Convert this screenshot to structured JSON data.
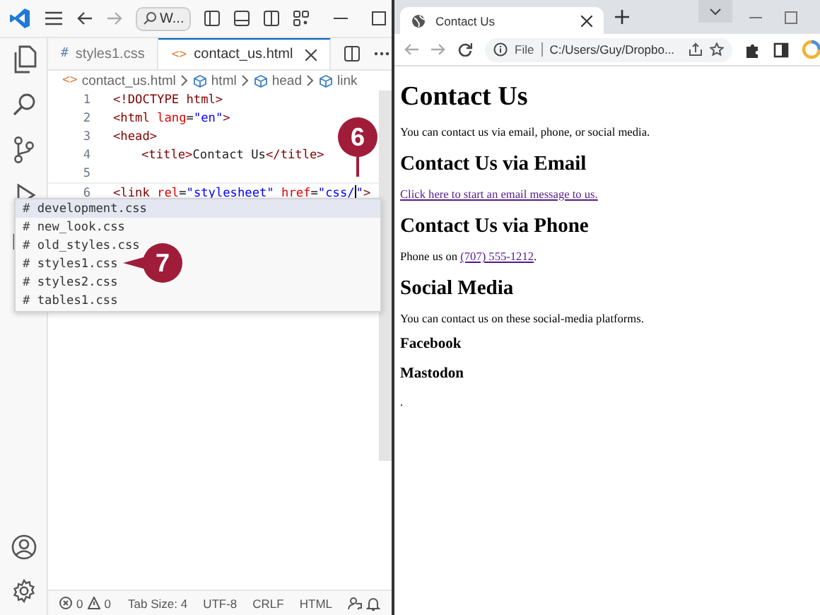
{
  "editor": {
    "command_center": "W...",
    "tabs": [
      {
        "icon": "#",
        "label": "styles1.css",
        "kind": "css",
        "selected": false
      },
      {
        "icon": "<>",
        "label": "contact_us.html",
        "kind": "html",
        "selected": true
      }
    ],
    "breadcrumbs": [
      {
        "icon": "<>",
        "label": "contact_us.html",
        "kind": "file"
      },
      {
        "label": "html",
        "kind": "element"
      },
      {
        "label": "head",
        "kind": "element"
      },
      {
        "label": "link",
        "kind": "element"
      }
    ],
    "lines": [
      {
        "number": "1",
        "current": false,
        "tokens": [
          {
            "kind": "tag",
            "text": "<!DOCTYPE html>"
          }
        ]
      },
      {
        "number": "2",
        "current": false,
        "tokens": [
          {
            "kind": "tag",
            "text": "<html"
          },
          {
            "kind": "attr",
            "text": " lang"
          },
          {
            "kind": "plain",
            "text": "="
          },
          {
            "kind": "string",
            "text": "\"en\""
          },
          {
            "kind": "tag",
            "text": ">"
          }
        ]
      },
      {
        "number": "3",
        "current": false,
        "tokens": [
          {
            "kind": "tag",
            "text": "<head>"
          }
        ]
      },
      {
        "number": "4",
        "current": false,
        "indented": true,
        "tokens": [
          {
            "kind": "tag",
            "text": "<title>"
          },
          {
            "kind": "plain",
            "text": "Contact Us"
          },
          {
            "kind": "tag",
            "text": "</title>"
          }
        ]
      },
      {
        "number": "5",
        "current": false
      },
      {
        "number": "6",
        "current": true,
        "tokens": [
          {
            "kind": "tag",
            "text": "<link"
          },
          {
            "kind": "attr",
            "text": " rel"
          },
          {
            "kind": "plain",
            "text": "="
          },
          {
            "kind": "string",
            "text": "\"stylesheet\""
          },
          {
            "kind": "attr",
            "text": " href"
          },
          {
            "kind": "plain",
            "text": "="
          },
          {
            "kind": "string",
            "text": "\"css/",
            "link": true,
            "cursor_after": true
          },
          {
            "kind": "string",
            "text": "\""
          },
          {
            "kind": "tag",
            "text": ">"
          }
        ]
      }
    ],
    "suggestions": [
      {
        "icon": "#",
        "label": "development.css",
        "selected": true
      },
      {
        "icon": "#",
        "label": "new_look.css",
        "selected": false
      },
      {
        "icon": "#",
        "label": "old_styles.css",
        "selected": false
      },
      {
        "icon": "#",
        "label": "styles1.css",
        "selected": false
      },
      {
        "icon": "#",
        "label": "styles2.css",
        "selected": false
      },
      {
        "icon": "#",
        "label": "tables1.css",
        "selected": false
      }
    ],
    "status_bar": {
      "errors": "0",
      "warnings": "0",
      "items": [
        "Tab Size: 4",
        "UTF-8",
        "CRLF",
        "HTML"
      ]
    }
  },
  "callouts": [
    {
      "label": "6",
      "kind": "down"
    },
    {
      "label": "7",
      "kind": "left"
    }
  ],
  "browser": {
    "tab": {
      "title": "Contact Us"
    },
    "address": {
      "scheme": "File",
      "url": "C:/Users/Guy/Dropbo..."
    },
    "page": [
      {
        "kind": "h1",
        "text": "Contact Us"
      },
      {
        "kind": "p",
        "text": "You can contact us via email, phone, or social media."
      },
      {
        "kind": "h2",
        "text": "Contact Us via Email"
      },
      {
        "kind": "link",
        "text": "Click here to start an email message to us."
      },
      {
        "kind": "h2",
        "text": "Contact Us via Phone"
      },
      {
        "kind": "p",
        "text": "Phone us on ",
        "link": "(707) 555-1212",
        "after": "."
      },
      {
        "kind": "h2",
        "text": "Social Media"
      },
      {
        "kind": "p",
        "text": "You can contact us on these social-media platforms."
      },
      {
        "kind": "h4",
        "text": "Facebook"
      },
      {
        "kind": "h4",
        "text": "Mastodon"
      },
      {
        "kind": "p",
        "text": "."
      }
    ]
  }
}
